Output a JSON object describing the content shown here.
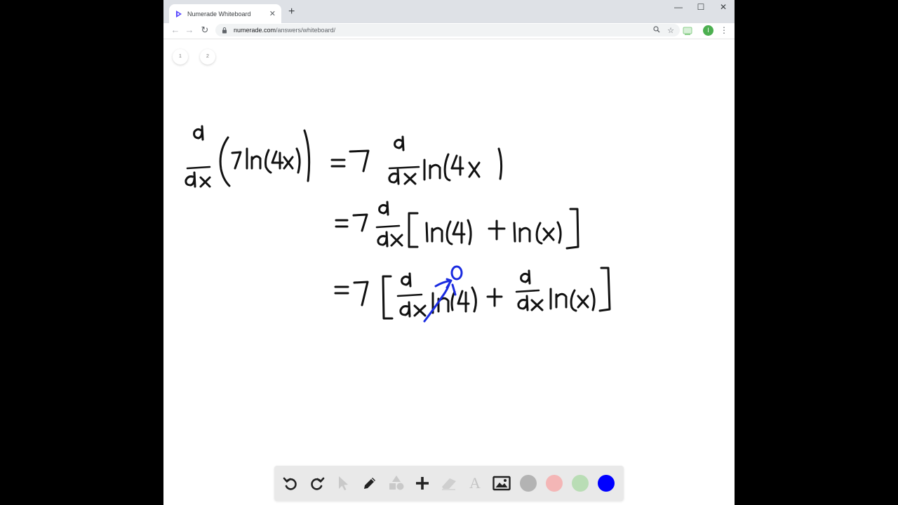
{
  "browser": {
    "tab_title": "Numerade Whiteboard",
    "tab_close": "✕",
    "new_tab": "+",
    "window_controls": {
      "minimize": "—",
      "maximize": "☐",
      "close": "✕"
    },
    "nav": {
      "back": "←",
      "forward": "→",
      "reload": "↻"
    },
    "url_host": "numerade.com",
    "url_path": "/answers/whiteboard/",
    "omni_icons": {
      "zoom": "🔍",
      "star": "☆"
    },
    "profile_initial": "I",
    "menu": "⋮"
  },
  "whiteboard": {
    "pages": [
      "1",
      "2"
    ],
    "handwriting": {
      "line1": "d/dx (7 ln(4x)) = 7 d/dx ln(4x)",
      "line2": "= 7 d/dx [ ln(4) + ln(x) ]",
      "line3": "= 7 [ d/dx ln(4) + d/dx ln(x) ]",
      "annotation": "0"
    },
    "ink_colors": {
      "black": "#111111",
      "blue": "#1a2be0"
    },
    "toolbar": {
      "tools": [
        "undo-icon",
        "redo-icon",
        "pointer-icon",
        "pen-icon",
        "shapes-icon",
        "plus-icon",
        "eraser-icon",
        "text-icon",
        "image-icon"
      ],
      "text_tool_label": "A",
      "swatches": [
        "#b3b3b3",
        "#f4b6b6",
        "#b9ddb5",
        "#0000ff"
      ]
    }
  }
}
